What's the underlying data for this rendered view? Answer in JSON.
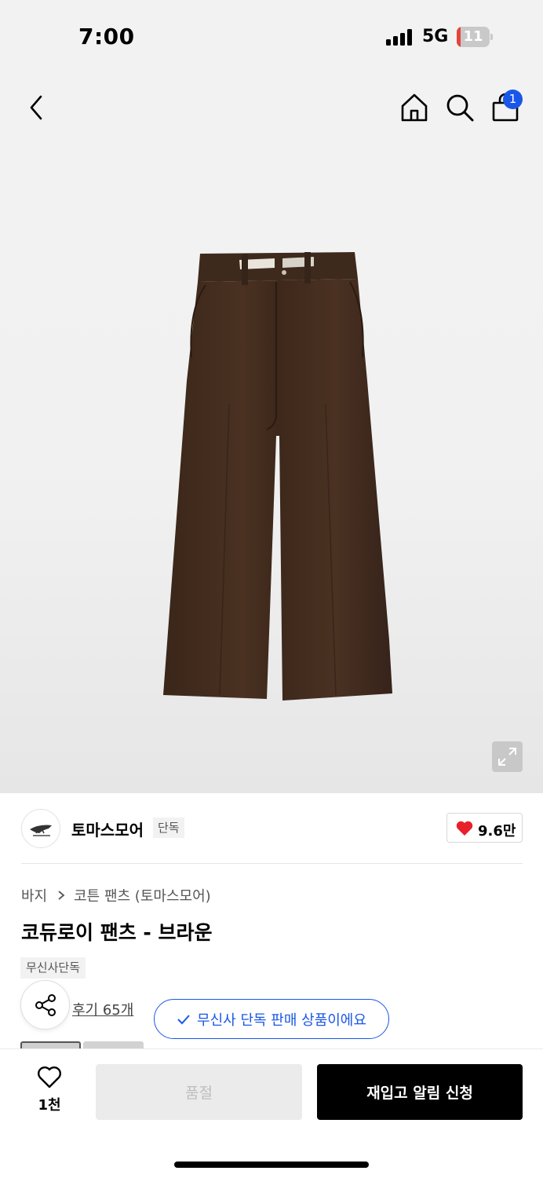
{
  "status_bar": {
    "time": "7:00",
    "network": "5G",
    "battery_level": "11",
    "battery_fraction": 0.11,
    "signal_bars": 4
  },
  "header": {
    "back_icon": "chevron-left-icon",
    "home_icon": "home-icon",
    "search_icon": "search-icon",
    "cart_icon": "shopping-bag-icon",
    "cart_badge": "1",
    "badge_color": "#1a57e8"
  },
  "product_image": {
    "icon": "corduroy-pants-image",
    "expand_icon": "expand-icon"
  },
  "brand": {
    "logo_icon": "brand-logo-icon",
    "name": "토마스모어",
    "tag": "단독",
    "like_icon": "heart-filled-icon",
    "like_count": "9.6만",
    "like_color": "#e8202a"
  },
  "product": {
    "breadcrumb": [
      "바지",
      "코튼 팬츠 (토마스모어)"
    ],
    "title": "코듀로이 팬츠 - 브라운",
    "exclusive_tag": "무신사단독",
    "share_icon": "share-icon",
    "review_link": "후기 65개",
    "exclusive_notice": "무신사 단독 판매 상품이에요",
    "accent_color": "#1a57e8"
  },
  "bottom_bar": {
    "wish_icon": "heart-outline-icon",
    "wish_count": "1천",
    "soldout_label": "품절",
    "restock_label": "재입고 알림 신청"
  }
}
